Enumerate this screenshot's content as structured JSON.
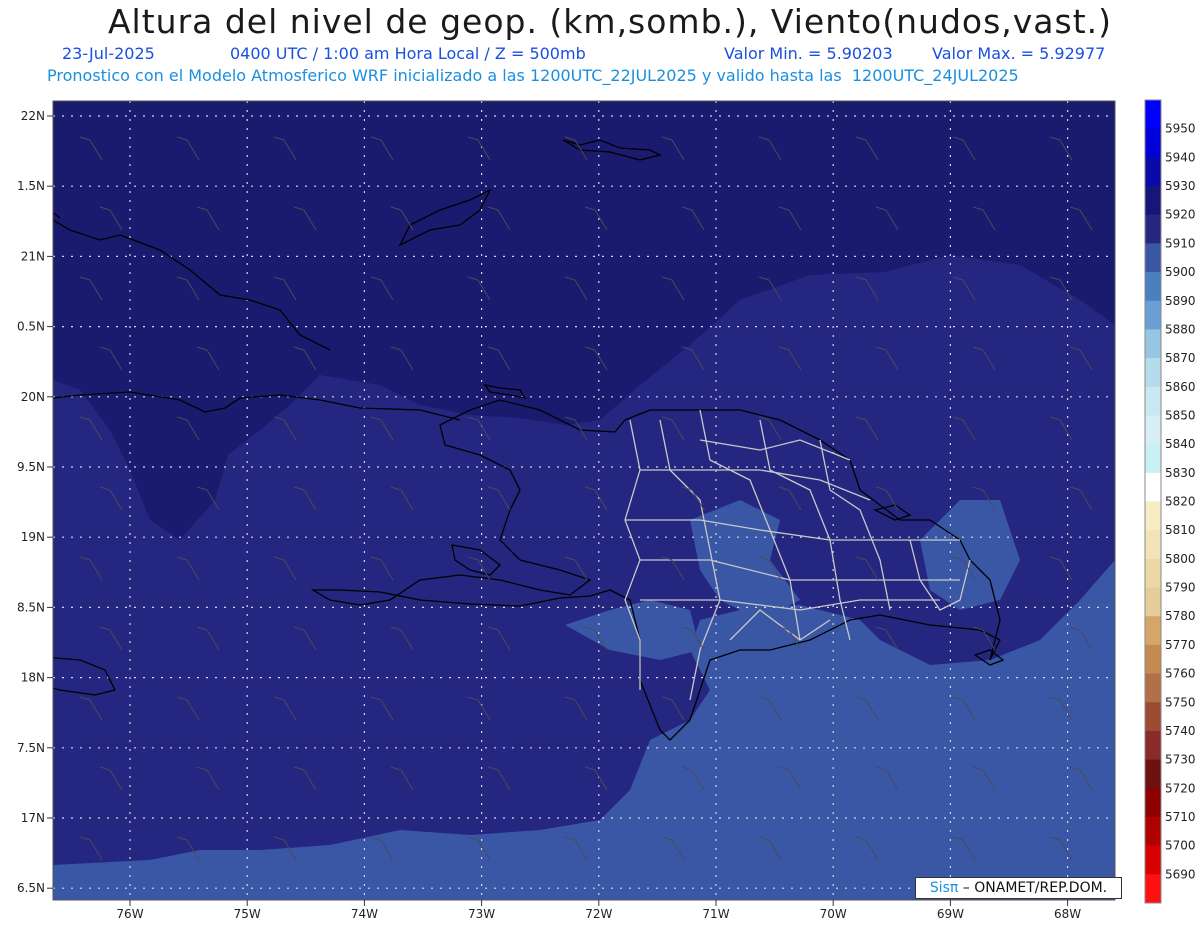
{
  "header": {
    "title": "Altura del nivel de geop. (km,somb.), Viento(nudos,vast.)",
    "date": "23-Jul-2025",
    "time": "0400 UTC / 1:00 am Hora Local / Z = 500mb",
    "min_label": "Valor Min. = 5.90203",
    "max_label": "Valor Max. = 5.92977",
    "model_line": "Pronostico con el Modelo Atmosferico WRF inicializado a las 1200UTC_22JUL2025 y valido hasta las  1200UTC_24JUL2025"
  },
  "map": {
    "lat_labels": [
      "22N",
      "1.5N",
      "21N",
      "0.5N",
      "20N",
      "9.5N",
      "19N",
      "8.5N",
      "18N",
      "7.5N",
      "17N",
      "6.5N"
    ],
    "lon_labels": [
      "76W",
      "75W",
      "74W",
      "73W",
      "72W",
      "71W",
      "70W",
      "69W",
      "68W"
    ],
    "fill_colors": {
      "level_5920": "#1a1a6e",
      "level_5910": "#252680",
      "level_5900": "#3a57a6",
      "level_5890": "#4a7fc0"
    }
  },
  "colorbar": {
    "levels": [
      {
        "value": "5950",
        "color": "#0000ff"
      },
      {
        "value": "5940",
        "color": "#0000d8"
      },
      {
        "value": "5930",
        "color": "#0a0aa8"
      },
      {
        "value": "5920",
        "color": "#16167a"
      },
      {
        "value": "5910",
        "color": "#252680"
      },
      {
        "value": "5900",
        "color": "#3a57a6"
      },
      {
        "value": "5890",
        "color": "#4a7fc0"
      },
      {
        "value": "5880",
        "color": "#6a9fd4"
      },
      {
        "value": "5870",
        "color": "#96c6e2"
      },
      {
        "value": "5860",
        "color": "#b4dcec"
      },
      {
        "value": "5850",
        "color": "#c8e8f2"
      },
      {
        "value": "5840",
        "color": "#d8eef6"
      },
      {
        "value": "5830",
        "color": "#c8f0f4"
      },
      {
        "value": "5820",
        "color": "#ffffff"
      },
      {
        "value": "5810",
        "color": "#f7ecc4"
      },
      {
        "value": "5800",
        "color": "#f2e4b8"
      },
      {
        "value": "5790",
        "color": "#ecd8a6"
      },
      {
        "value": "5780",
        "color": "#e6cc98"
      },
      {
        "value": "5770",
        "color": "#d4a66a"
      },
      {
        "value": "5760",
        "color": "#c48a52"
      },
      {
        "value": "5750",
        "color": "#b27048"
      },
      {
        "value": "5740",
        "color": "#9c4a32"
      },
      {
        "value": "5730",
        "color": "#8a2a2a"
      },
      {
        "value": "5720",
        "color": "#6e1010"
      },
      {
        "value": "5710",
        "color": "#8e0000"
      },
      {
        "value": "5700",
        "color": "#b00000"
      },
      {
        "value": "5690",
        "color": "#d80000"
      },
      {
        "value": "",
        "color": "#ff1010"
      }
    ]
  },
  "credit": {
    "sis": "Sisπ",
    "org": " – ONAMET/REP.DOM."
  }
}
